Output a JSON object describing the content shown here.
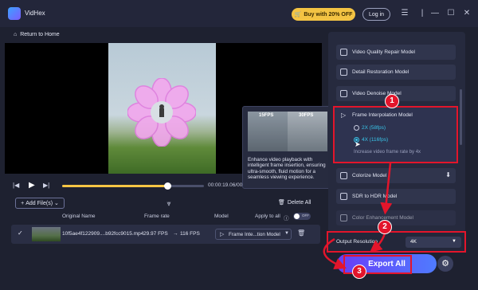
{
  "app": {
    "name": "VidHex",
    "buy_label": "Buy with 20% OFF",
    "login_label": "Log in"
  },
  "nav": {
    "home_label": "Return to Home"
  },
  "player": {
    "time": "00:00:19.06/00",
    "progress": 0.74
  },
  "tooltip": {
    "fps_left": "15FPS",
    "fps_right": "30FPS",
    "text": "Enhance video playback with intelligent frame insertion, ensuring ultra-smooth, fluid motion for a seamless viewing experience."
  },
  "files": {
    "add_label": "Add File(s)",
    "delete_all_label": "Delete All",
    "headers": {
      "name": "Original Name",
      "frame_rate": "Frame rate",
      "model": "Model",
      "apply_all": "Apply to all"
    },
    "toggle_label": "OFF",
    "rows": [
      {
        "name": "10f5ae4f122909....b92fcc9015.mp4",
        "frame_rate": "29.97 FPS",
        "arrow": "→",
        "target_fps": "116 FPS",
        "model": "Frame Inte...tion Model"
      }
    ]
  },
  "models": {
    "items": [
      {
        "label": "Video Quality Repair Model",
        "icon": "video-repair-icon"
      },
      {
        "label": "Detail Restoration Model",
        "icon": "detail-icon"
      },
      {
        "label": "Video Denoise Model",
        "icon": "denoise-icon"
      },
      {
        "label": "Colorize Model",
        "icon": "colorize-icon"
      },
      {
        "label": "SDR to HDR Model",
        "icon": "hdr-icon"
      },
      {
        "label": "Color Enhancement Model",
        "icon": "color-enhance-icon"
      }
    ],
    "selected": {
      "label": "Frame Interpolation Model",
      "options": [
        {
          "label": "2X (58fps)",
          "selected": false
        },
        {
          "label": "4X (116fps)",
          "selected": true
        }
      ],
      "description": "Increase video frame rate by 4x"
    }
  },
  "output": {
    "label": "Output Resolution",
    "value": "4K"
  },
  "export_label": "Export All",
  "steps": [
    "1",
    "2",
    "3"
  ],
  "colors": {
    "accent": "#f3c343",
    "highlight": "#e3152b",
    "export_start": "#6a3cf7",
    "export_end": "#4f7bff"
  }
}
